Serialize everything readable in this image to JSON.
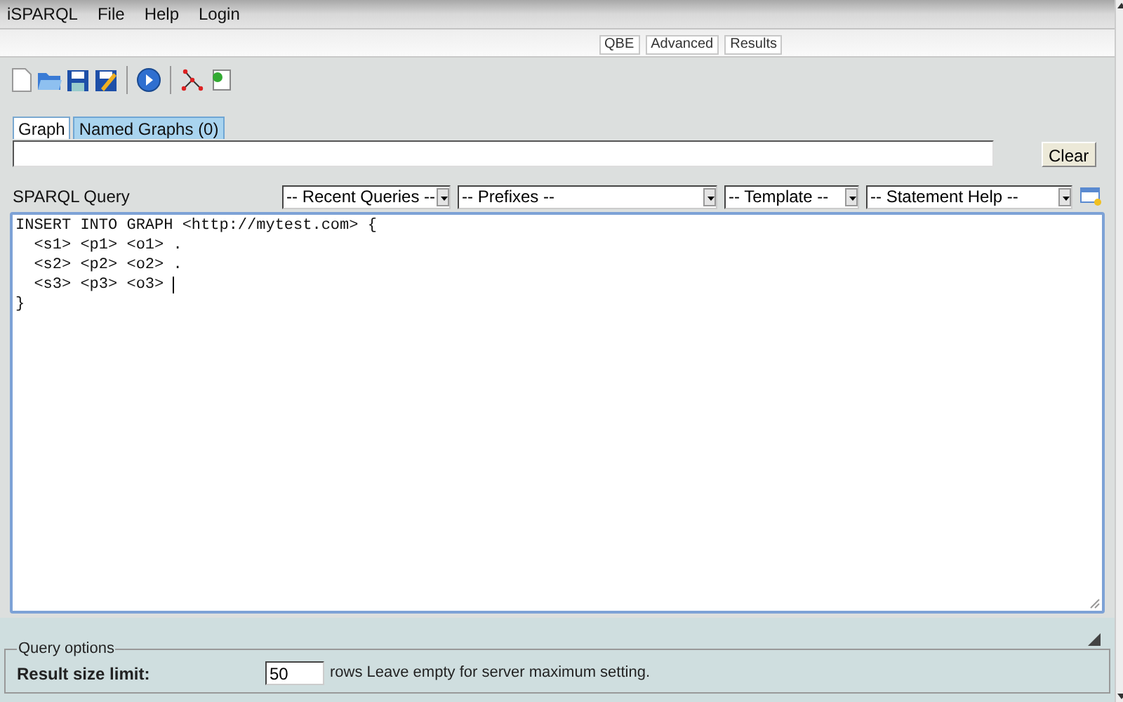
{
  "menu": [
    "iSPARQL",
    "File",
    "Help",
    "Login"
  ],
  "view_tabs": [
    {
      "label": "QBE"
    },
    {
      "label": "Advanced"
    },
    {
      "label": "Results"
    }
  ],
  "graph_tabs": [
    {
      "label": "Graph",
      "selected": true
    },
    {
      "label": "Named Graphs (0)",
      "selected": false
    }
  ],
  "clear_button": "Clear",
  "query": {
    "title": "SPARQL Query",
    "dropdowns": [
      "-- Recent Queries --",
      "-- Prefixes --",
      "-- Template --",
      "-- Statement Help --"
    ],
    "lines": [
      "INSERT INTO GRAPH <http://mytest.com> {",
      "  <s1> <p1> <o1> .",
      "  <s2> <p2> <o2> .",
      "  <s3> <p3> <o3> ",
      "}"
    ]
  },
  "options": {
    "legend": "Query options",
    "label": "Result size limit:",
    "value": "50",
    "hint": "rows Leave empty for server maximum setting."
  }
}
